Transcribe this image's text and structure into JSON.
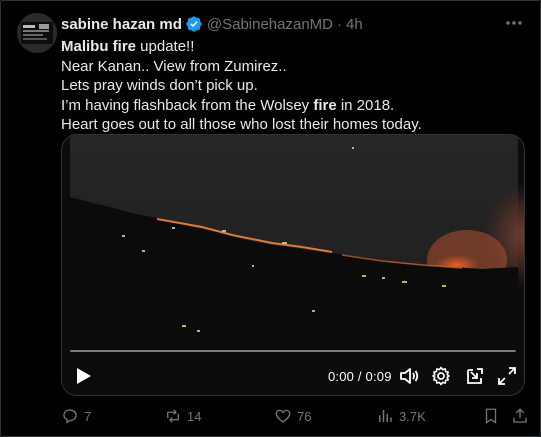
{
  "tweet": {
    "author_name": "sabine hazan md",
    "handle": "@SabinehazanMD",
    "separator": "·",
    "time": "4h",
    "text_lines": [
      [
        {
          "t": "Malibu ",
          "bold": true
        },
        {
          "t": "fire",
          "bold": true
        },
        {
          "t": " update!!",
          "bold": false
        }
      ],
      [
        {
          "t": "Near Kanan.. View from Zumirez..",
          "bold": false
        }
      ],
      [
        {
          "t": "Lets pray winds don’t pick up.",
          "bold": false
        }
      ],
      [
        {
          "t": "I’m having flashback from the Wolsey ",
          "bold": false
        },
        {
          "t": "fire",
          "bold": true
        },
        {
          "t": " in 2018.",
          "bold": false
        }
      ],
      [
        {
          "t": "Heart goes out to all those who lost their homes today.",
          "bold": false
        }
      ]
    ]
  },
  "video": {
    "timecode": "0:00 / 0:09",
    "progress": 0.0
  },
  "actions": {
    "replies": "7",
    "reposts": "14",
    "likes": "76",
    "views": "3.7K"
  },
  "colors": {
    "background": "#000000",
    "text": "#e7e9ea",
    "muted": "#71767b",
    "verified": "#1d9bf0",
    "border": "#2f3336"
  },
  "icons": [
    "avatar",
    "verified-badge-icon",
    "more-icon",
    "play-icon",
    "volume-icon",
    "settings-icon",
    "popout-icon",
    "fullscreen-icon",
    "reply-icon",
    "repost-icon",
    "like-icon",
    "views-icon",
    "bookmark-icon",
    "share-icon"
  ]
}
